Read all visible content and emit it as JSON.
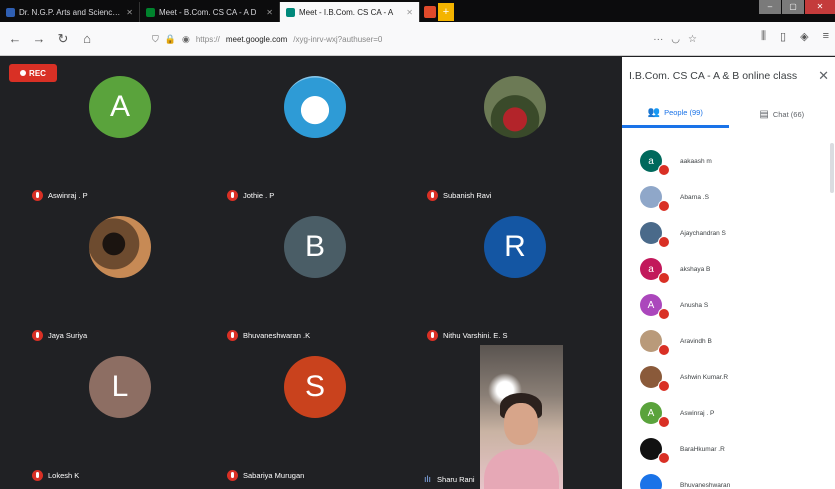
{
  "browser": {
    "tabs": [
      {
        "title": "Dr. N.G.P. Arts and Science Co",
        "active": false,
        "color": "#2f5fb3"
      },
      {
        "title": "Meet - B.Com. CS CA - A D",
        "active": false,
        "color": "#00832d"
      },
      {
        "title": "Meet - I.B.Com. CS CA - A",
        "active": true,
        "color": "#00897b"
      }
    ],
    "url_prefix": "https://",
    "url_domain": "meet.google.com",
    "url_path": "/xyg-inrv-wxj?authuser=0"
  },
  "meet": {
    "rec_label": "REC",
    "tiles": [
      {
        "name": "Aswinraj . P",
        "initial": "A",
        "color": "#5aa33c",
        "photo": ""
      },
      {
        "name": "Jothie . P",
        "initial": "",
        "color": "",
        "photo": "photo-doraemon"
      },
      {
        "name": "Subanish Ravi",
        "initial": "",
        "color": "",
        "photo": "photo-red"
      },
      {
        "name": "Jaya Suriya",
        "initial": "",
        "color": "",
        "photo": "photo-dark"
      },
      {
        "name": "Bhuvaneshwaran .K",
        "initial": "B",
        "color": "#4a5d66",
        "photo": ""
      },
      {
        "name": "Nithu Varshini. E. S",
        "initial": "R",
        "color": "#1456a3",
        "photo": ""
      },
      {
        "name": "Lokesh K",
        "initial": "L",
        "color": "#8d6e63",
        "photo": ""
      },
      {
        "name": "Sabariya Murugan",
        "initial": "S",
        "color": "#c9421d",
        "photo": ""
      }
    ],
    "video_participant": "Sharu Rani"
  },
  "panel": {
    "title": "I.B.Com. CS CA - A & B online class",
    "tabs": [
      {
        "label": "People (99)",
        "icon": "people-icon",
        "active": true
      },
      {
        "label": "Chat (66)",
        "icon": "chat-icon",
        "active": false
      }
    ],
    "people": [
      {
        "name": "aakaash m",
        "initial": "a",
        "color": "#00695c"
      },
      {
        "name": "Abarna .S",
        "initial": "",
        "color": "#8fa7c9"
      },
      {
        "name": "Ajaychandran S",
        "initial": "",
        "color": "#4a6a8a"
      },
      {
        "name": "akshaya B",
        "initial": "a",
        "color": "#c2185b"
      },
      {
        "name": "Anusha S",
        "initial": "A",
        "color": "#ab47bc"
      },
      {
        "name": "Aravindh B",
        "initial": "",
        "color": "#b99a7a"
      },
      {
        "name": "Ashwin Kumar.R",
        "initial": "",
        "color": "#8a5a3a"
      },
      {
        "name": "Aswinraj . P",
        "initial": "A",
        "color": "#5aa33c"
      },
      {
        "name": "BaraHkumar .R",
        "initial": "",
        "color": "#111111"
      },
      {
        "name": "Bhuvaneshwaran",
        "initial": "",
        "color": "#1a73e8"
      }
    ]
  }
}
